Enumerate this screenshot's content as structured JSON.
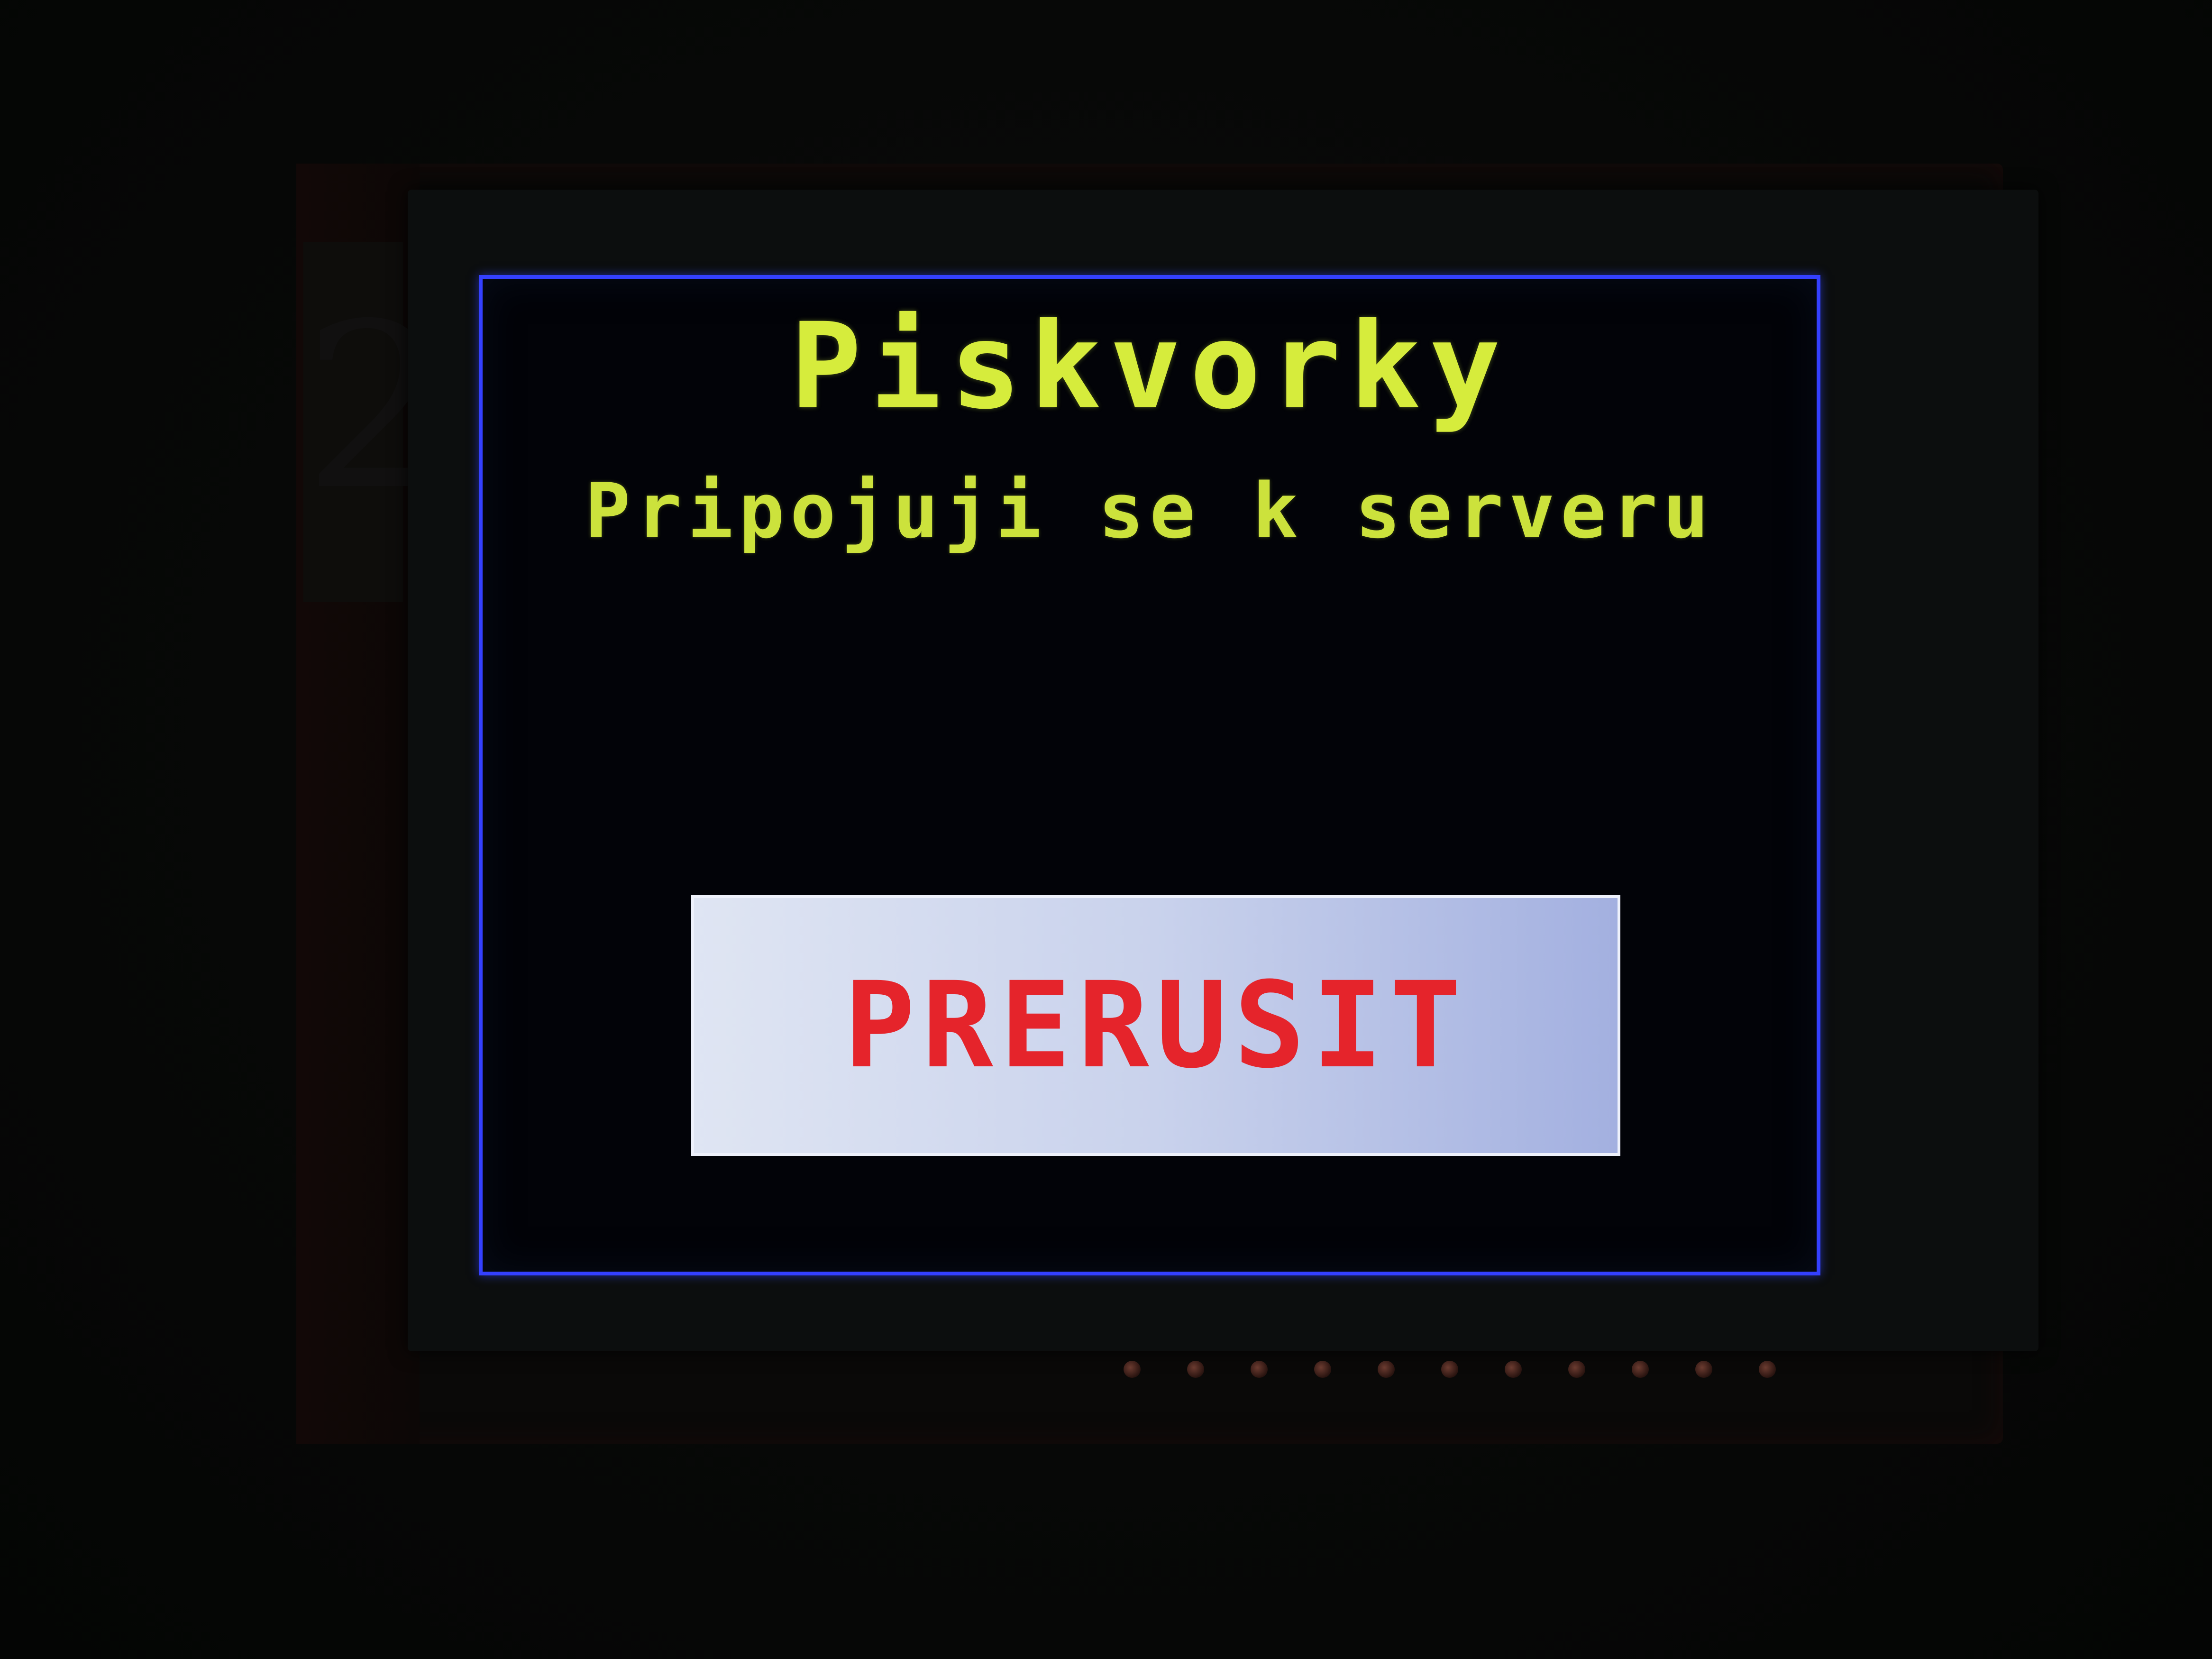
{
  "screen": {
    "title": "Piskvorky",
    "status": "Pripojuji se k serveru",
    "cancel_button_label": "PRERUSIT"
  },
  "device": {
    "sticker_mark": "2"
  },
  "colors": {
    "screen_border": "#3440ff",
    "title_text": "#d6ec3c",
    "status_text": "#cce23c",
    "button_background": "#c9d2ec",
    "button_text": "#e5242b"
  }
}
